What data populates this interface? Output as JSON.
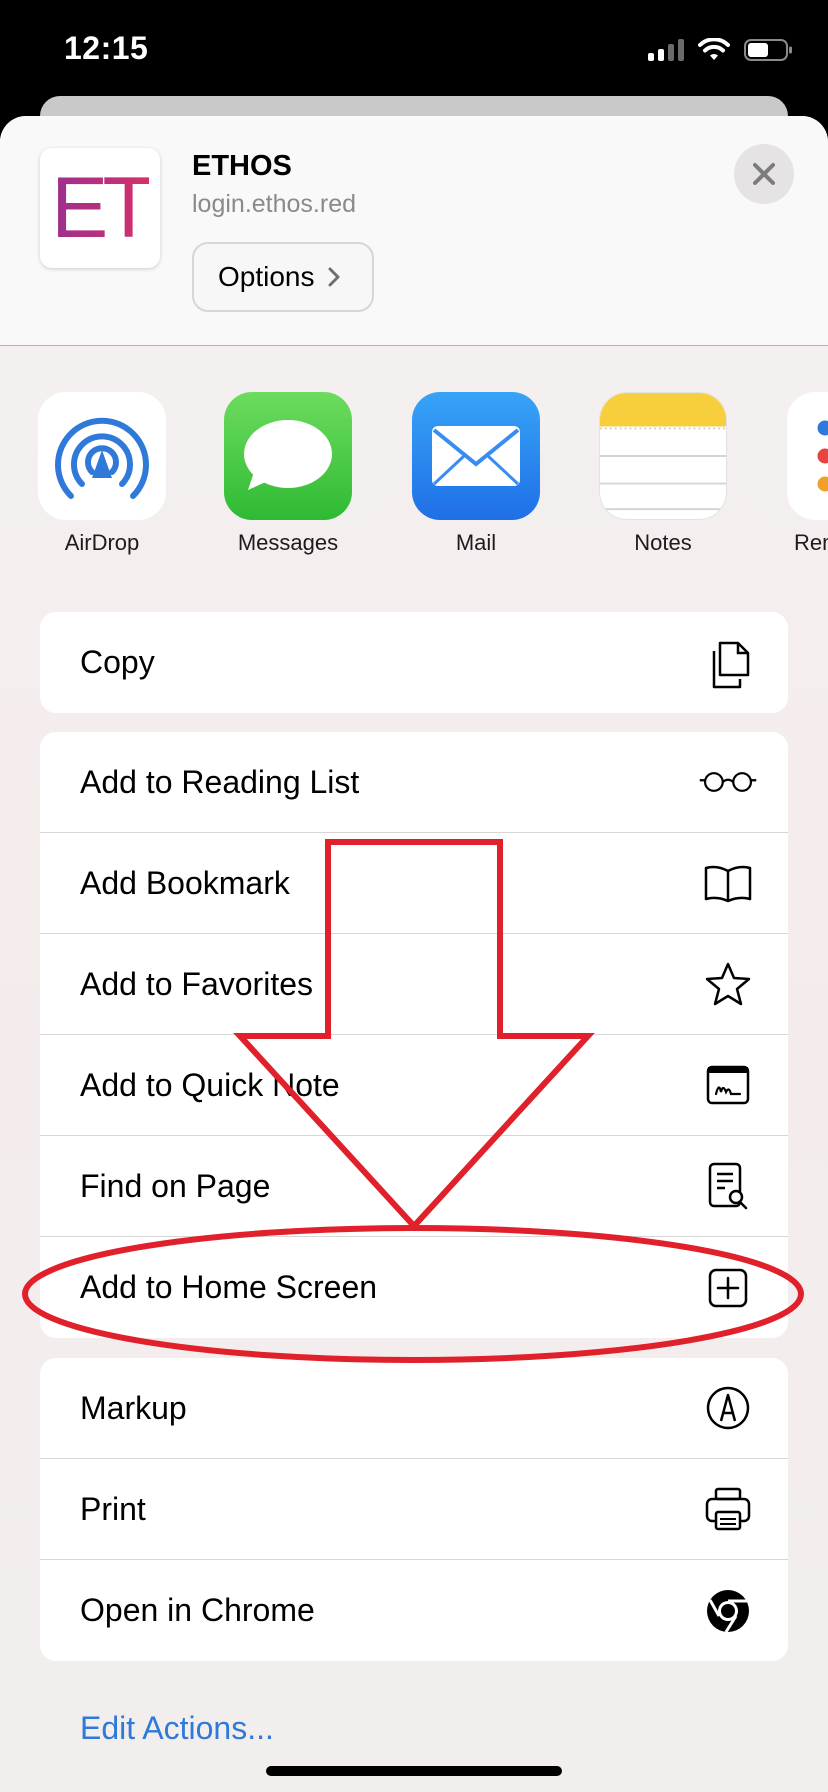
{
  "status": {
    "time": "12:15"
  },
  "header": {
    "thumb_text": "ET",
    "title": "ETHOS",
    "url": "login.ethos.red",
    "options_label": "Options"
  },
  "apps": [
    {
      "label": "AirDrop",
      "icon": "airdrop-icon"
    },
    {
      "label": "Messages",
      "icon": "messages-icon"
    },
    {
      "label": "Mail",
      "icon": "mail-icon"
    },
    {
      "label": "Notes",
      "icon": "notes-icon"
    },
    {
      "label": "Rem",
      "icon": "reminders-icon"
    }
  ],
  "actions": {
    "copy": "Copy",
    "reading_list": "Add to Reading List",
    "bookmark": "Add Bookmark",
    "favorites": "Add to Favorites",
    "quick_note": "Add to Quick Note",
    "find_on_page": "Find on Page",
    "home_screen": "Add to Home Screen",
    "markup": "Markup",
    "print": "Print",
    "open_chrome": "Open in Chrome"
  },
  "edit_actions": "Edit Actions...",
  "colors": {
    "annotation": "#e0202a",
    "link": "#2f7ad9"
  }
}
